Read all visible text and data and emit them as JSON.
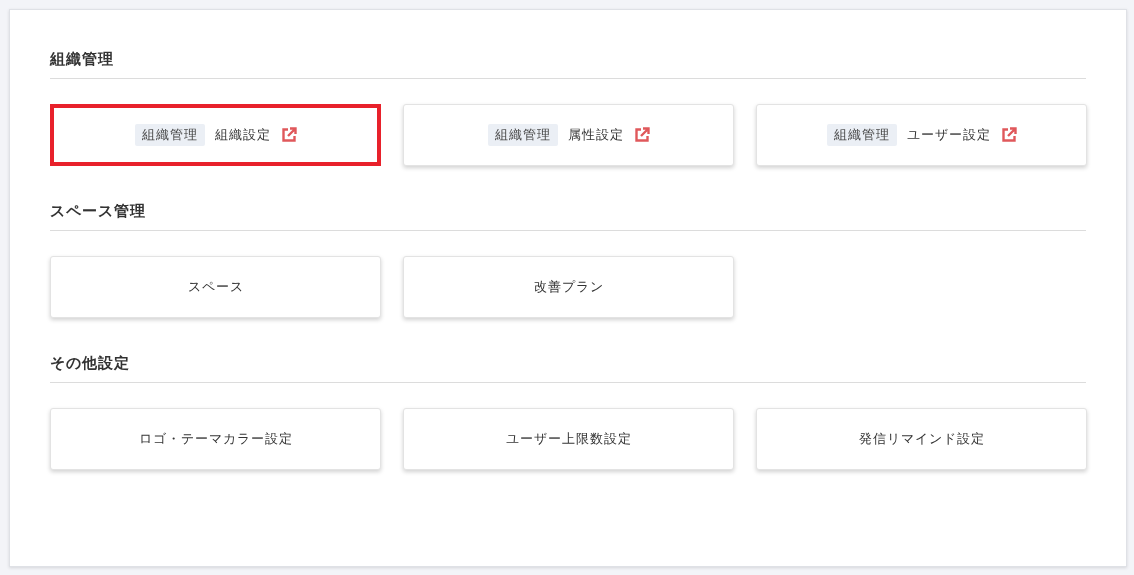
{
  "sections": [
    {
      "title": "組織管理",
      "cards": [
        {
          "tag": "組織管理",
          "label": "組織設定",
          "external": true,
          "highlighted": true
        },
        {
          "tag": "組織管理",
          "label": "属性設定",
          "external": true,
          "highlighted": false
        },
        {
          "tag": "組織管理",
          "label": "ユーザー設定",
          "external": true,
          "highlighted": false
        }
      ]
    },
    {
      "title": "スペース管理",
      "cards": [
        {
          "label": "スペース",
          "external": false,
          "highlighted": false
        },
        {
          "label": "改善プラン",
          "external": false,
          "highlighted": false
        }
      ]
    },
    {
      "title": "その他設定",
      "cards": [
        {
          "label": "ロゴ・テーマカラー設定",
          "external": false,
          "highlighted": false
        },
        {
          "label": "ユーザー上限数設定",
          "external": false,
          "highlighted": false
        },
        {
          "label": "発信リマインド設定",
          "external": false,
          "highlighted": false
        }
      ]
    }
  ]
}
